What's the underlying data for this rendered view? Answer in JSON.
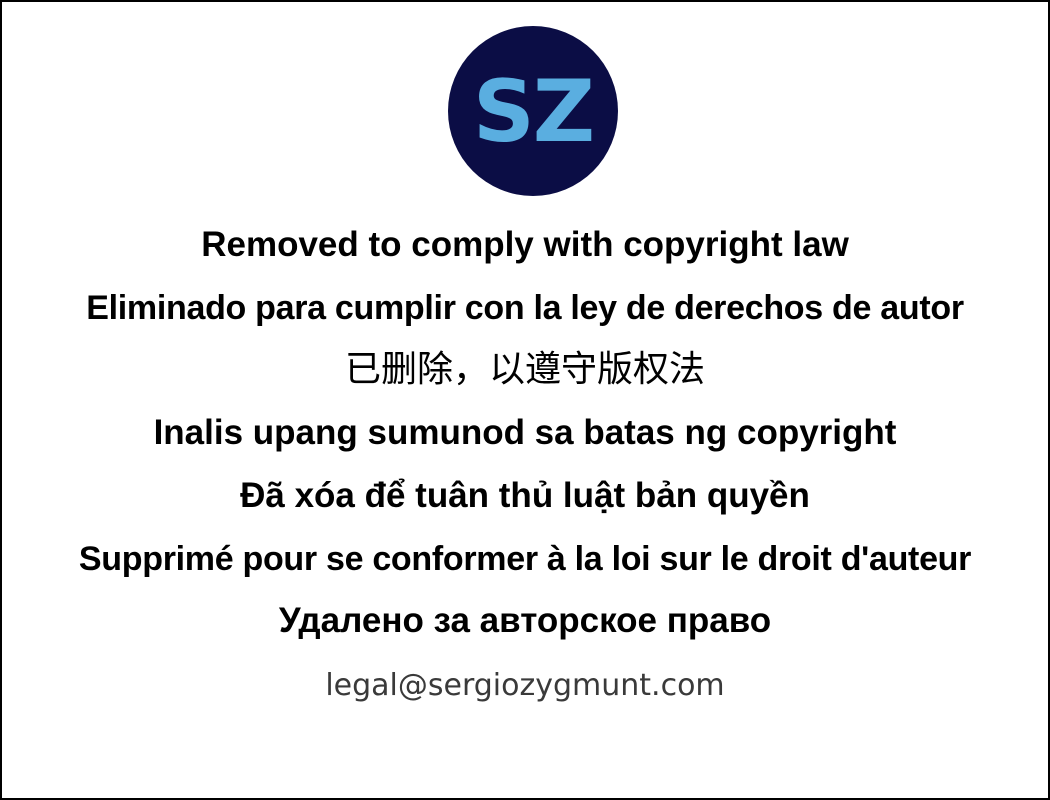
{
  "logo": {
    "text": "SZ",
    "background_color": "#0b0d45",
    "text_color": "#5aaee0"
  },
  "messages": [
    "Removed to comply with copyright law",
    "Eliminado para cumplir con la ley de derechos de autor",
    "已删除，以遵守版权法",
    "Inalis upang sumunod sa batas ng copyright",
    "Đã xóa để tuân thủ luật bản quyền",
    "Supprimé pour se conformer à la loi sur le droit d'auteur",
    "Удалено за авторское право"
  ],
  "contact_email": "legal@sergiozygmunt.com"
}
